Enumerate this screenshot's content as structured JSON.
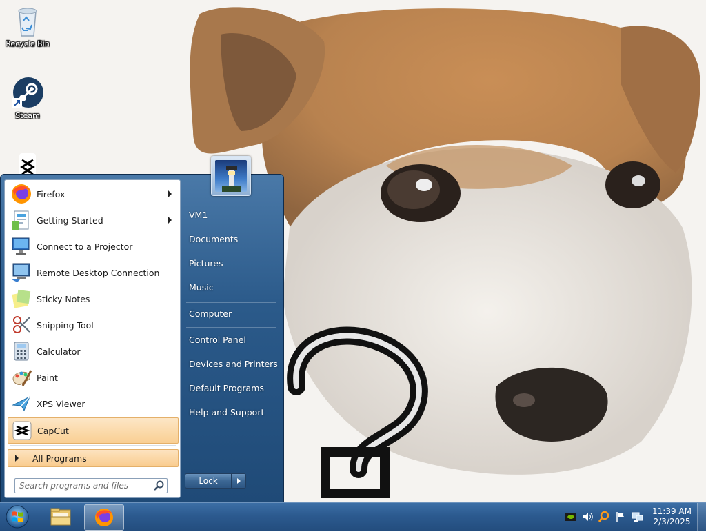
{
  "desktop": {
    "icons": [
      {
        "label": "Recycle Bin",
        "icon": "recycle-bin-icon"
      },
      {
        "label": "Steam",
        "icon": "steam-icon"
      },
      {
        "label": "",
        "icon": "capcut-icon"
      }
    ]
  },
  "start_menu": {
    "programs": [
      {
        "label": "Firefox",
        "icon": "firefox-icon",
        "has_submenu": true
      },
      {
        "label": "Getting Started",
        "icon": "getting-started-icon",
        "has_submenu": true
      },
      {
        "label": "Connect to a Projector",
        "icon": "projector-icon",
        "has_submenu": false
      },
      {
        "label": "Remote Desktop Connection",
        "icon": "remote-desktop-icon",
        "has_submenu": false
      },
      {
        "label": "Sticky Notes",
        "icon": "sticky-notes-icon",
        "has_submenu": false
      },
      {
        "label": "Snipping Tool",
        "icon": "snipping-tool-icon",
        "has_submenu": false
      },
      {
        "label": "Calculator",
        "icon": "calculator-icon",
        "has_submenu": false
      },
      {
        "label": "Paint",
        "icon": "paint-icon",
        "has_submenu": false
      },
      {
        "label": "XPS Viewer",
        "icon": "xps-viewer-icon",
        "has_submenu": false
      },
      {
        "label": "CapCut",
        "icon": "capcut-icon",
        "has_submenu": false,
        "highlighted": true
      }
    ],
    "all_programs_label": "All Programs",
    "search_placeholder": "Search programs and files",
    "right_items": [
      {
        "label": "VM1"
      },
      {
        "label": "Documents"
      },
      {
        "label": "Pictures"
      },
      {
        "label": "Music"
      },
      {
        "label": "Computer"
      },
      {
        "label": "Control Panel"
      },
      {
        "label": "Devices and Printers"
      },
      {
        "label": "Default Programs"
      },
      {
        "label": "Help and Support"
      }
    ],
    "lock_label": "Lock"
  },
  "taskbar": {
    "pinned": [
      {
        "name": "windows-explorer",
        "icon": "folder-icon"
      },
      {
        "name": "firefox",
        "icon": "firefox-icon",
        "active": true
      }
    ],
    "tray_icons": [
      "nvidia-icon",
      "volume-icon",
      "search-icon",
      "flag-icon",
      "network-icon"
    ],
    "clock_time": "11:39 AM",
    "clock_date": "2/3/2025"
  },
  "colors": {
    "taskbar": "#2c5a8f",
    "start_menu_right": "#2b5a8a",
    "highlight": "#f9cf93"
  }
}
